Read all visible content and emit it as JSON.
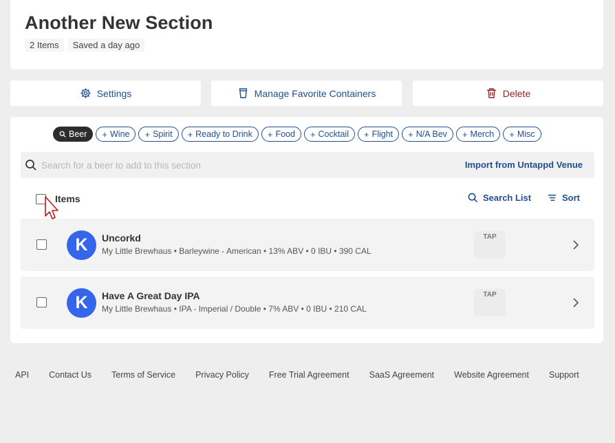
{
  "header": {
    "title": "Another New Section",
    "item_count": "2 Items",
    "saved": "Saved a day ago"
  },
  "actions": {
    "settings": "Settings",
    "containers": "Manage Favorite Containers",
    "delete": "Delete"
  },
  "categories": [
    {
      "label": "Beer",
      "active": true
    },
    {
      "label": "Wine",
      "active": false
    },
    {
      "label": "Spirit",
      "active": false
    },
    {
      "label": "Ready to Drink",
      "active": false
    },
    {
      "label": "Food",
      "active": false
    },
    {
      "label": "Cocktail",
      "active": false
    },
    {
      "label": "Flight",
      "active": false
    },
    {
      "label": "N/A Bev",
      "active": false
    },
    {
      "label": "Merch",
      "active": false
    },
    {
      "label": "Misc",
      "active": false
    }
  ],
  "search": {
    "placeholder": "Search for a beer to add to this section",
    "value": "",
    "import_label": "Import from Untappd Venue"
  },
  "list": {
    "items_label": "Items",
    "search_list": "Search List",
    "sort": "Sort"
  },
  "items": [
    {
      "initial": "K",
      "name": "Uncorkd",
      "meta": "My Little Brewhaus • Barleywine - American • 13% ABV • 0 IBU • 390 CAL",
      "badge": "TAP"
    },
    {
      "initial": "K",
      "name": "Have A Great Day IPA",
      "meta": "My Little Brewhaus • IPA - Imperial / Double • 7% ABV • 0 IBU • 210 CAL",
      "badge": "TAP"
    }
  ],
  "footer": [
    "API",
    "Contact Us",
    "Terms of Service",
    "Privacy Policy",
    "Free Trial Agreement",
    "SaaS Agreement",
    "Website Agreement",
    "Support"
  ],
  "colors": {
    "accent": "#1f4f8f",
    "danger": "#9a2323",
    "avatar": "#3565ea",
    "active_pill": "#2d2d2d"
  }
}
